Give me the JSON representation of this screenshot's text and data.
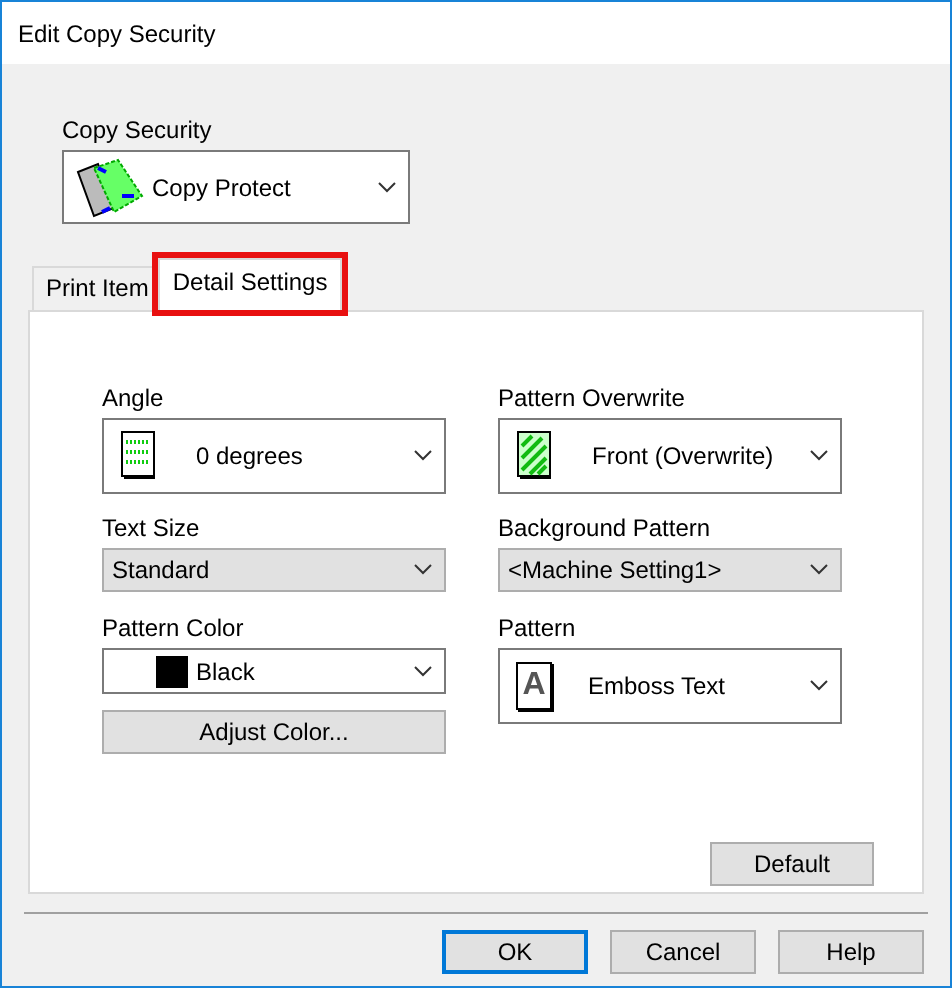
{
  "window": {
    "title": "Edit Copy Security"
  },
  "copy_security": {
    "label": "Copy Security",
    "value": "Copy Protect"
  },
  "tabs": [
    {
      "label": "Print Item",
      "selected": false,
      "highlighted": false
    },
    {
      "label": "Detail Settings",
      "selected": true,
      "highlighted": true
    }
  ],
  "left_fields": [
    {
      "label": "Angle",
      "kind": "icon",
      "value": "0 degrees"
    },
    {
      "label": "Text Size",
      "kind": "plain",
      "value": "Standard"
    },
    {
      "label": "Pattern Color",
      "kind": "swatch",
      "value": "Black"
    }
  ],
  "adjust_button": "Adjust Color...",
  "right_fields": [
    {
      "label": "Pattern Overwrite",
      "kind": "icon",
      "value": "Front (Overwrite)"
    },
    {
      "label": "Background Pattern",
      "kind": "plain",
      "value": "<Machine Setting1>"
    },
    {
      "label": "Pattern",
      "kind": "icon",
      "icon_letter": "A",
      "value": "Emboss Text"
    }
  ],
  "default_button": "Default",
  "buttons": [
    {
      "label": "OK",
      "default": true
    },
    {
      "label": "Cancel",
      "default": false
    },
    {
      "label": "Help",
      "default": false
    }
  ]
}
